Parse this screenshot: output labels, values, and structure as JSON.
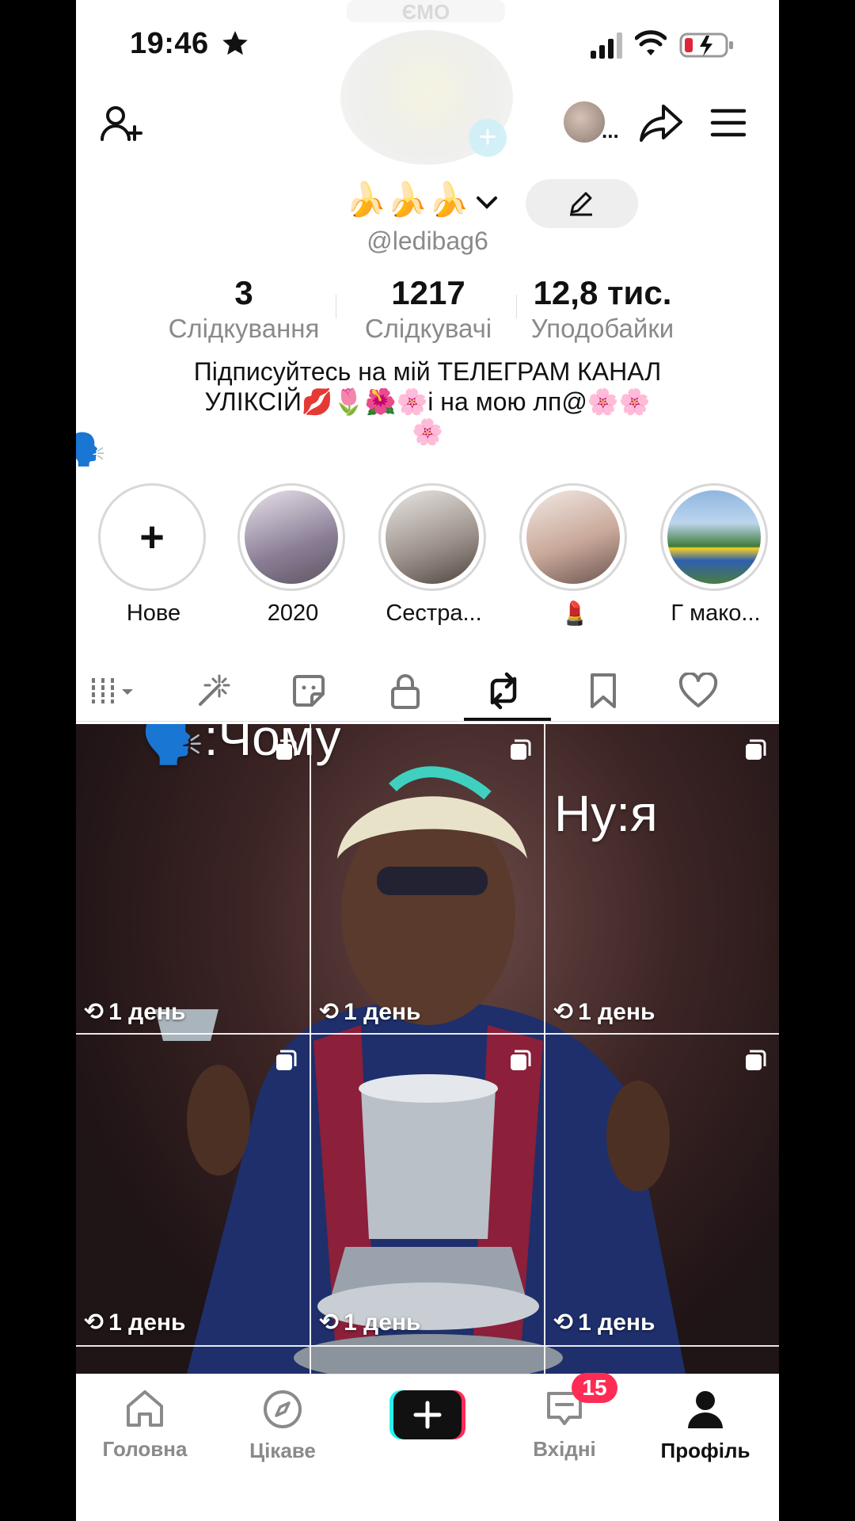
{
  "status_bar": {
    "time": "19:46"
  },
  "avatar": {
    "label": "ЄМО"
  },
  "profile": {
    "display_name": "🍌🍌🍌",
    "username": "@ledibag6",
    "stats": [
      {
        "value": "3",
        "label": "Слідкування"
      },
      {
        "value": "1217",
        "label": "Слідкувачі"
      },
      {
        "value": "12,8 тис.",
        "label": "Уподобайки"
      }
    ],
    "bio_line1": "Підписуйтесь на мій ТЕЛЕГРАМ КАНАЛ",
    "bio_line2": "УЛІКСІЙ💋🌷🌺🌸і на мою лп@🌸🌸",
    "bio_line3": "🌸",
    "bio_emoji": "🗣️",
    "header_dots": "..."
  },
  "highlights": [
    {
      "label": "Нове",
      "type": "new"
    },
    {
      "label": "2020",
      "type": "photo",
      "color": "#a9a0b8"
    },
    {
      "label": "Сестра...",
      "type": "photo",
      "color": "#9a8f88"
    },
    {
      "label": "💄",
      "type": "photo",
      "color": "#c9a89a"
    },
    {
      "label": "Г мако...",
      "type": "photo",
      "color": "#6fa07a"
    }
  ],
  "grid": {
    "items": [
      {
        "time": "1 день"
      },
      {
        "time": "1 день"
      },
      {
        "time": "1 день"
      },
      {
        "time": "1 день"
      },
      {
        "time": "1 день"
      },
      {
        "time": "1 день"
      }
    ],
    "overlay_left": "🗣️:Чому",
    "overlay_right": "Ну:я"
  },
  "nav": {
    "home": "Головна",
    "explore": "Цікаве",
    "inbox": "Вхідні",
    "inbox_badge": "15",
    "profile": "Профіль"
  },
  "colors": {
    "accent_red": "#fe2c55",
    "accent_cyan": "#25f4ee",
    "text": "#111111",
    "muted": "#8a8a8a"
  }
}
